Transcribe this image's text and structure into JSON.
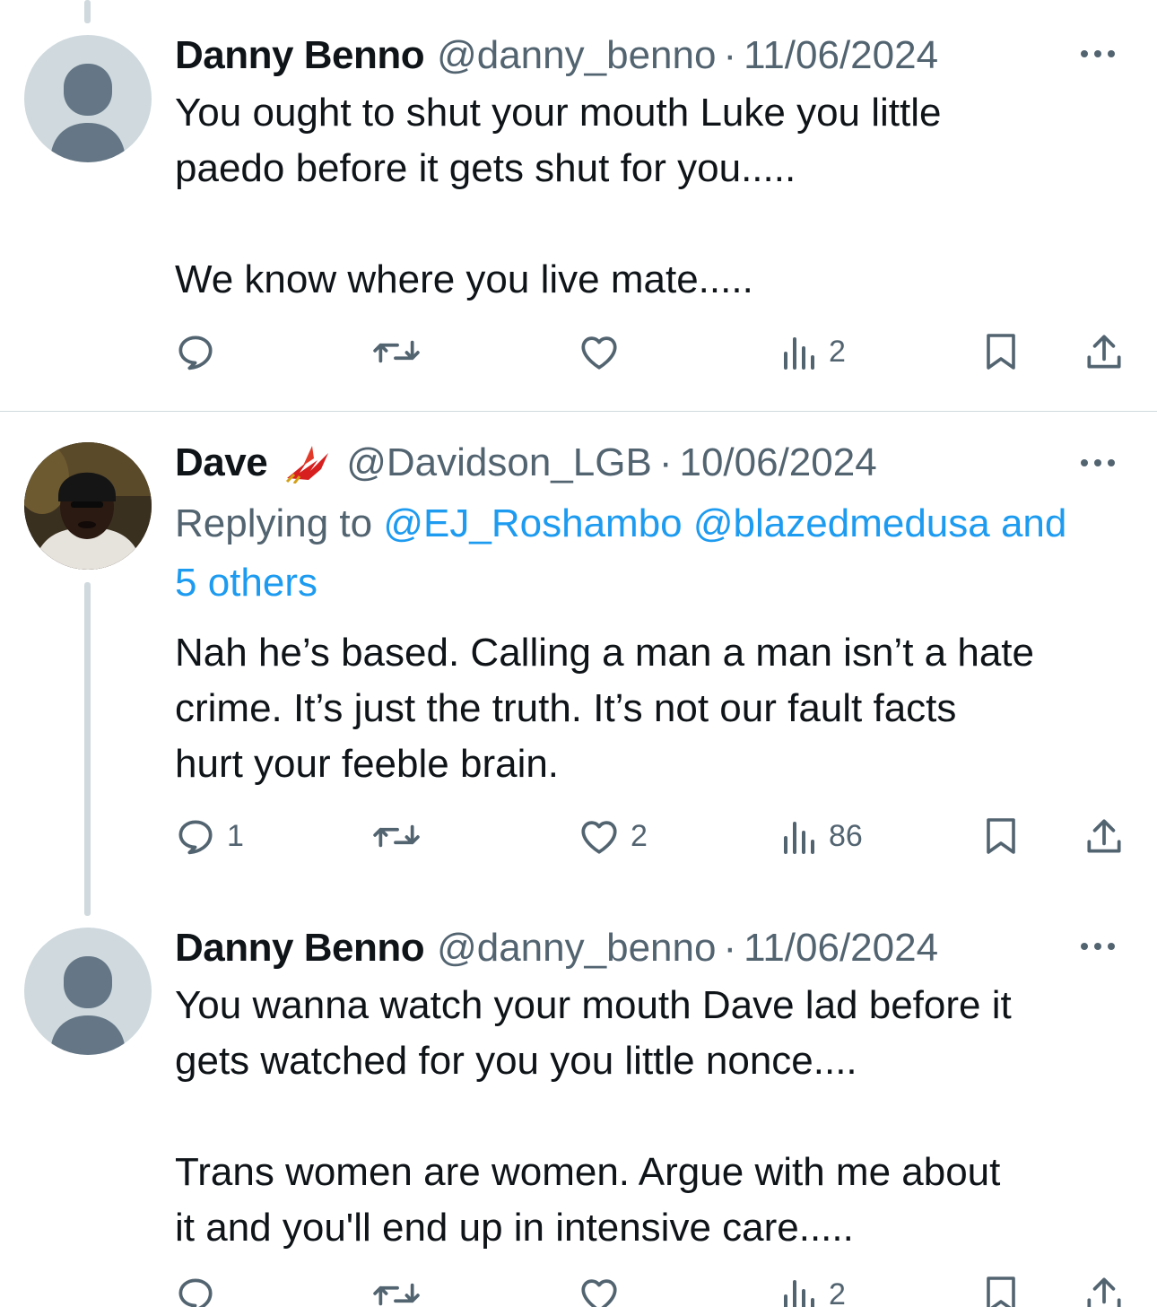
{
  "tweets": [
    {
      "name": "Danny Benno",
      "handle": "@danny_benno",
      "separator": "·",
      "date": "11/06/2024",
      "text_lines": [
        "You ought to shut your mouth Luke you little",
        "paedo before it gets shut for you.....",
        "We know where you live mate....."
      ],
      "counts": {
        "replies": "",
        "reposts": "",
        "likes": "",
        "views": "2"
      }
    },
    {
      "name": "Dave",
      "handle": "@Davidson_LGB",
      "separator": "·",
      "date": "10/06/2024",
      "replying_label": "Replying to",
      "replying_mentions": "@EJ_Roshambo @blazedmedusa and",
      "replying_others": "5 others",
      "text_lines": [
        "Nah he’s based. Calling a man a man isn’t a hate",
        "crime. It’s just the truth. It’s not our fault facts",
        "hurt your feeble brain."
      ],
      "counts": {
        "replies": "1",
        "reposts": "",
        "likes": "2",
        "views": "86"
      }
    },
    {
      "name": "Danny Benno",
      "handle": "@danny_benno",
      "separator": "·",
      "date": "11/06/2024",
      "text_lines": [
        "You wanna watch your mouth Dave lad before it",
        "gets watched for you you little nonce....",
        "Trans women are women.  Argue with me about",
        "it and you'll end up in intensive care....."
      ],
      "counts": {
        "replies": "",
        "reposts": "",
        "likes": "",
        "views": "2"
      }
    }
  ],
  "icons": {
    "reply": "reply-icon",
    "repost": "repost-icon",
    "like": "like-icon",
    "views": "views-icon",
    "bookmark": "bookmark-icon",
    "share": "share-icon",
    "more": "more-icon",
    "flag": "phoenix-flag-icon"
  },
  "colors": {
    "text": "#0f1419",
    "secondary": "#536471",
    "link": "#1d9bf0",
    "divider": "#cfd9de",
    "default_avatar_bg": "#cfd9de",
    "default_avatar_fg": "#657786"
  }
}
